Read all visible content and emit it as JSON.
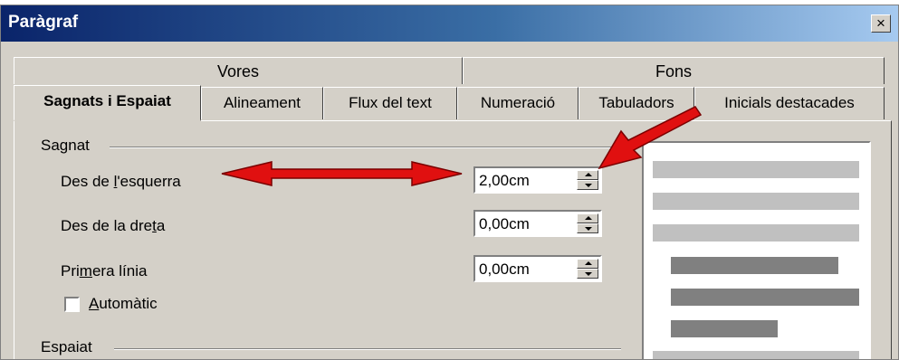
{
  "window": {
    "title": "Paràgraf",
    "close_label": "×"
  },
  "tabs_back": [
    {
      "label": "Vores"
    },
    {
      "label": "Fons"
    }
  ],
  "tabs_front": [
    {
      "label": "Sagnats i Espaiat",
      "active": true
    },
    {
      "label": "Alineament"
    },
    {
      "label": "Flux del text"
    },
    {
      "label": "Numeració"
    },
    {
      "label": "Tabuladors"
    },
    {
      "label": "Inicials destacades"
    }
  ],
  "indent": {
    "group_label": "Sagnat",
    "left": {
      "pre": "Des de ",
      "key": "l",
      "post": "'esquerra",
      "value": "2,00cm"
    },
    "right": {
      "pre": "Des de la dre",
      "key": "t",
      "post": "a",
      "value": "0,00cm"
    },
    "first": {
      "pre": "Pri",
      "key": "m",
      "post": "era línia",
      "value": "0,00cm"
    },
    "auto": {
      "pre": "",
      "key": "A",
      "post": "utomàtic",
      "checked": false
    }
  },
  "spacing": {
    "group_label": "Espaiat"
  },
  "colors": {
    "annotation_arrow": "#e01010",
    "title_start": "#0a246a",
    "dialog_bg": "#d4d0c8"
  }
}
